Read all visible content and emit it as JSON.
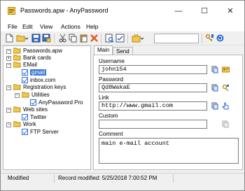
{
  "window": {
    "title": "Passwords.apw - AnyPassword",
    "controls": {
      "minimize": "—",
      "maximize": "☐",
      "close": "✕"
    }
  },
  "menu": [
    "File",
    "Edit",
    "View",
    "Actions",
    "Help"
  ],
  "toolbar": {
    "search_value": "",
    "icons": [
      "new-file-icon",
      "open-folder-icon",
      "save-icon",
      "save-as-icon",
      "cut-icon",
      "copy-icon",
      "paste-icon",
      "delete-icon",
      "find-icon",
      "properties-icon",
      "clipboard-icon",
      "key-icon",
      "refresh-icon",
      "help-icon"
    ]
  },
  "tree": {
    "root": "Passwords.apw",
    "items": [
      {
        "label": "Bank cards",
        "type": "folder"
      },
      {
        "label": "EMail",
        "type": "folder"
      },
      {
        "label": "gmail",
        "type": "entry",
        "selected": true
      },
      {
        "label": "inbox.com",
        "type": "entry"
      },
      {
        "label": "Registration keys",
        "type": "folder"
      },
      {
        "label": "Utilities",
        "type": "folder"
      },
      {
        "label": "AnyPassword Pro",
        "type": "entry"
      },
      {
        "label": "Web sites",
        "type": "folder"
      },
      {
        "label": "Twitter",
        "type": "entry"
      },
      {
        "label": "Work",
        "type": "folder"
      },
      {
        "label": "FTP Server",
        "type": "entry"
      }
    ]
  },
  "tabs": [
    "Main",
    "Send"
  ],
  "fields": {
    "username_label": "Username",
    "username_value": "john154",
    "password_label": "Password",
    "password_value": "Qd8WakaE",
    "link_label": "Link",
    "link_value": "http://www.gmail.com",
    "custom_label": "Custom",
    "custom_value": "",
    "comment_label": "Comment",
    "comment_value": "main e-mail account"
  },
  "status": {
    "state": "Modified",
    "record": "Record modified: 5/25/2018 7:00:52 PM"
  }
}
